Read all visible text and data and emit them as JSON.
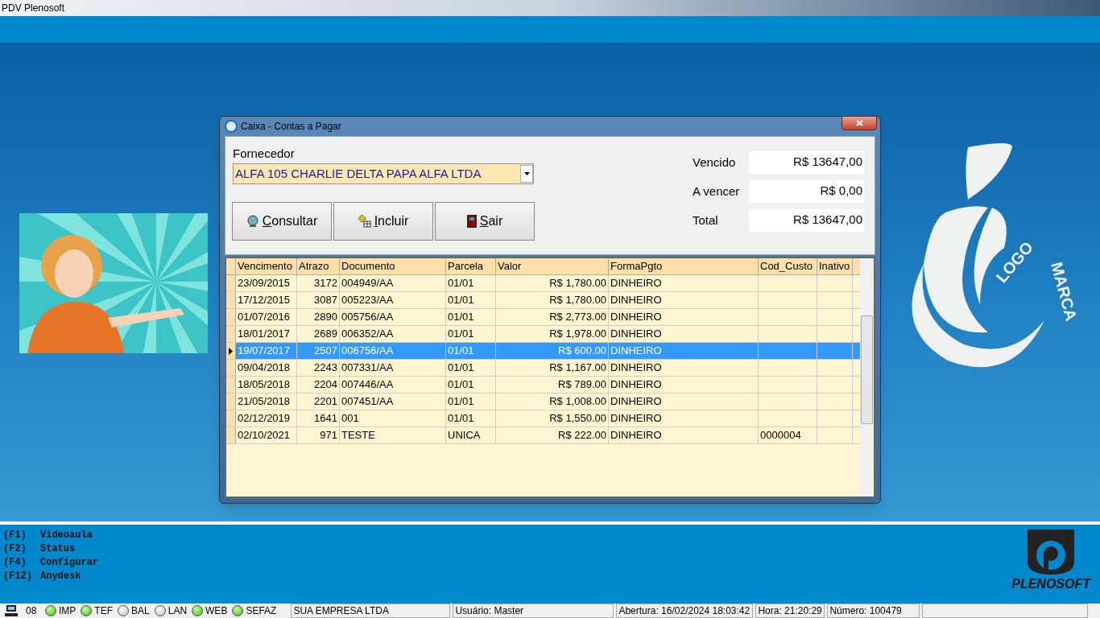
{
  "app_title": "PDV Plenosoft",
  "logo": {
    "words": [
      "LOGO",
      "MARCA"
    ]
  },
  "dialog": {
    "title": "Caixa - Contas a Pagar",
    "fornecedor": {
      "label": "Fornecedor",
      "value": "ALFA 105 CHARLIE DELTA PAPA ALFA LTDA"
    },
    "buttons": [
      {
        "label": "Consultar",
        "kind": "search"
      },
      {
        "label": "Incluir",
        "kind": "add"
      },
      {
        "label": "Sair",
        "kind": "exit"
      }
    ],
    "totals": [
      {
        "label": "Vencido",
        "value": "R$ 13647,00"
      },
      {
        "label": "A vencer",
        "value": "R$ 0,00"
      },
      {
        "label": "Total",
        "value": "R$ 13647,00"
      }
    ],
    "table": {
      "columns": [
        "Vencimento",
        "Atrazo",
        "Documento",
        "Parcela",
        "Valor",
        "FormaPgto",
        "Cod_Custo",
        "Inativo"
      ],
      "rows": [
        {
          "selected": false,
          "cells": [
            "23/09/2015",
            "3172",
            "004949/AA",
            "01/01",
            "R$ 1,780.00",
            "DINHEIRO",
            "",
            ""
          ]
        },
        {
          "selected": false,
          "cells": [
            "17/12/2015",
            "3087",
            "005223/AA",
            "01/01",
            "R$ 1,780.00",
            "DINHEIRO",
            "",
            ""
          ]
        },
        {
          "selected": false,
          "cells": [
            "01/07/2016",
            "2890",
            "005756/AA",
            "01/01",
            "R$ 2,773.00",
            "DINHEIRO",
            "",
            ""
          ]
        },
        {
          "selected": false,
          "cells": [
            "18/01/2017",
            "2689",
            "006352/AA",
            "01/01",
            "R$ 1,978.00",
            "DINHEIRO",
            "",
            ""
          ]
        },
        {
          "selected": true,
          "cells": [
            "19/07/2017",
            "2507",
            "006756/AA",
            "01/01",
            "R$ 600.00",
            "DINHEIRO",
            "",
            ""
          ]
        },
        {
          "selected": false,
          "cells": [
            "09/04/2018",
            "2243",
            "007331/AA",
            "01/01",
            "R$ 1,167.00",
            "DINHEIRO",
            "",
            ""
          ]
        },
        {
          "selected": false,
          "cells": [
            "18/05/2018",
            "2204",
            "007446/AA",
            "01/01",
            "R$ 789.00",
            "DINHEIRO",
            "",
            ""
          ]
        },
        {
          "selected": false,
          "cells": [
            "21/05/2018",
            "2201",
            "007451/AA",
            "01/01",
            "R$ 1,008.00",
            "DINHEIRO",
            "",
            ""
          ]
        },
        {
          "selected": false,
          "cells": [
            "02/12/2019",
            "1641",
            "001",
            "01/01",
            "R$ 1,550.00",
            "DINHEIRO",
            "",
            ""
          ]
        },
        {
          "selected": false,
          "cells": [
            "02/10/2021",
            "971",
            "TESTE",
            "UNICA",
            "R$ 222.00",
            "DINHEIRO",
            "0000004",
            ""
          ]
        }
      ]
    }
  },
  "shortcuts": [
    {
      "key": "(F1)",
      "label": "Videoaula"
    },
    {
      "key": "(F2)",
      "label": "Status"
    },
    {
      "key": "(F4)",
      "label": "Configurar"
    },
    {
      "key": "(F12)",
      "label": "Anydesk"
    }
  ],
  "brand": "PLENOSOFT",
  "status_bar": {
    "terminal": "08",
    "lights": [
      {
        "label": "IMP",
        "on": true
      },
      {
        "label": "TEF",
        "on": true
      },
      {
        "label": "BAL",
        "on": false
      },
      {
        "label": "LAN",
        "on": false
      },
      {
        "label": "WEB",
        "on": true
      },
      {
        "label": "SEFAZ",
        "on": true
      }
    ],
    "panels": [
      "SUA EMPRESA LTDA",
      "Usuário: Master",
      "Abertura: 16/02/2024 18:03:42",
      "Hora: 21:20:29",
      "Número: 100479"
    ]
  }
}
